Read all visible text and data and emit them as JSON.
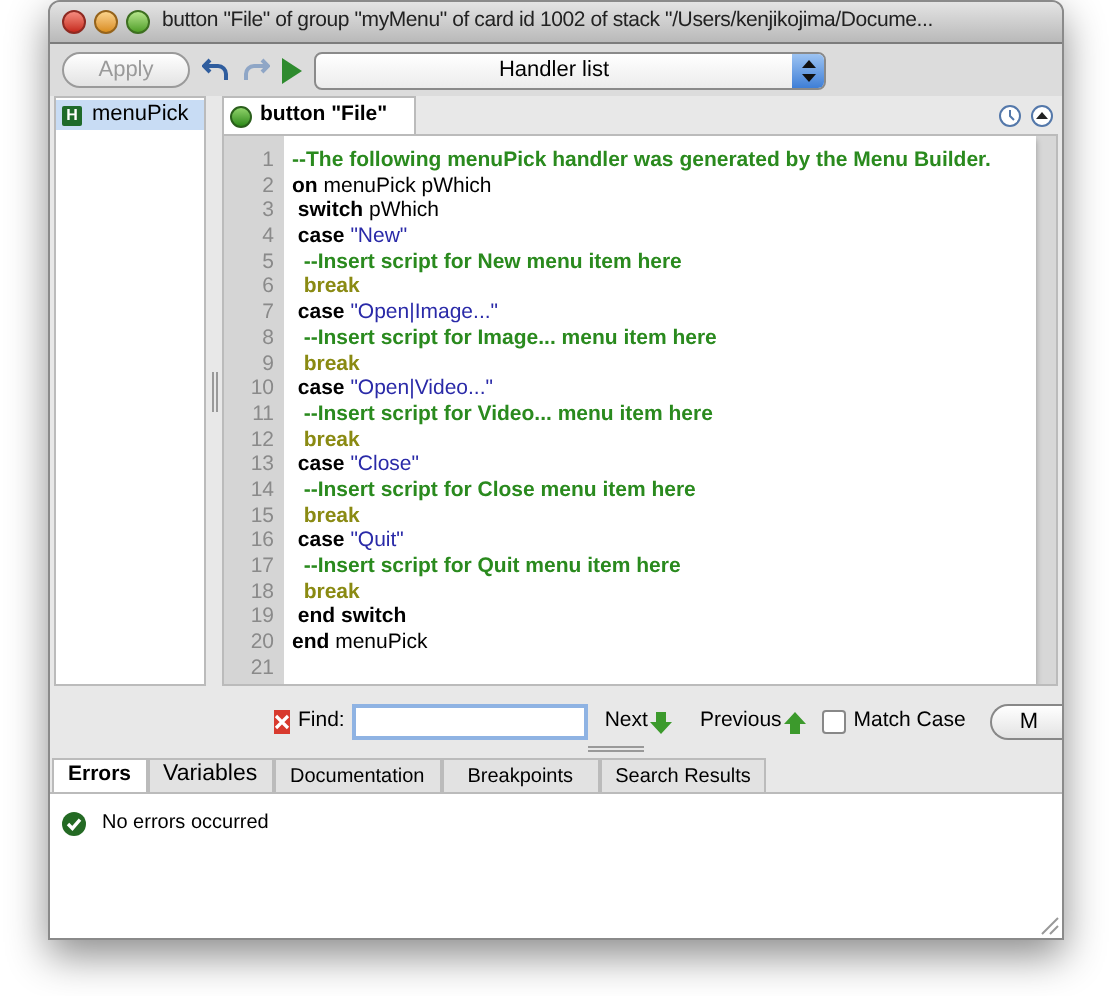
{
  "window": {
    "title": "button \"File\" of group \"myMenu\" of card id 1002 of stack \"/Users/kenjikojima/Docume..."
  },
  "toolbar": {
    "apply_button": {
      "label": "Apply",
      "disabled": true
    },
    "handler_list": {
      "value": "Handler list"
    }
  },
  "sidebar": {
    "items": [
      {
        "badge": "H",
        "label": "menuPick",
        "selected": true
      }
    ]
  },
  "editor": {
    "tab": {
      "label": "button \"File\""
    },
    "lines": [
      {
        "number": "1",
        "tokens": [
          {
            "kind": "comment",
            "text": "--The following menuPick handler was generated by the Menu Builder."
          }
        ]
      },
      {
        "number": "2",
        "tokens": [
          {
            "kind": "keyword",
            "text": "on"
          },
          {
            "kind": "plain",
            "text": " menuPick pWhich"
          }
        ]
      },
      {
        "number": "3",
        "tokens": [
          {
            "kind": "keyword",
            "text": " switch"
          },
          {
            "kind": "plain",
            "text": " pWhich"
          }
        ]
      },
      {
        "number": "4",
        "tokens": [
          {
            "kind": "keyword",
            "text": " case"
          },
          {
            "kind": "string",
            "text": " \"New\""
          }
        ]
      },
      {
        "number": "5",
        "tokens": [
          {
            "kind": "comment",
            "text": "  --Insert script for New menu item here"
          }
        ]
      },
      {
        "number": "6",
        "tokens": [
          {
            "kind": "break",
            "text": "  break"
          }
        ]
      },
      {
        "number": "7",
        "tokens": [
          {
            "kind": "keyword",
            "text": " case"
          },
          {
            "kind": "string",
            "text": " \"Open|Image...\""
          }
        ]
      },
      {
        "number": "8",
        "tokens": [
          {
            "kind": "comment",
            "text": "  --Insert script for Image... menu item here"
          }
        ]
      },
      {
        "number": "9",
        "tokens": [
          {
            "kind": "break",
            "text": "  break"
          }
        ]
      },
      {
        "number": "10",
        "tokens": [
          {
            "kind": "keyword",
            "text": " case"
          },
          {
            "kind": "string",
            "text": " \"Open|Video...\""
          }
        ]
      },
      {
        "number": "11",
        "tokens": [
          {
            "kind": "comment",
            "text": "  --Insert script for Video... menu item here"
          }
        ]
      },
      {
        "number": "12",
        "tokens": [
          {
            "kind": "break",
            "text": "  break"
          }
        ]
      },
      {
        "number": "13",
        "tokens": [
          {
            "kind": "keyword",
            "text": " case"
          },
          {
            "kind": "string",
            "text": " \"Close\""
          }
        ]
      },
      {
        "number": "14",
        "tokens": [
          {
            "kind": "comment",
            "text": "  --Insert script for Close menu item here"
          }
        ]
      },
      {
        "number": "15",
        "tokens": [
          {
            "kind": "break",
            "text": "  break"
          }
        ]
      },
      {
        "number": "16",
        "tokens": [
          {
            "kind": "keyword",
            "text": " case"
          },
          {
            "kind": "string",
            "text": " \"Quit\""
          }
        ]
      },
      {
        "number": "17",
        "tokens": [
          {
            "kind": "comment",
            "text": "  --Insert script for Quit menu item here"
          }
        ]
      },
      {
        "number": "18",
        "tokens": [
          {
            "kind": "break",
            "text": "  break"
          }
        ]
      },
      {
        "number": "19",
        "tokens": [
          {
            "kind": "keyword",
            "text": " end switch"
          }
        ]
      },
      {
        "number": "20",
        "tokens": [
          {
            "kind": "keyword",
            "text": "end"
          },
          {
            "kind": "plain",
            "text": " menuPick"
          }
        ]
      },
      {
        "number": "21"
      }
    ]
  },
  "find_bar": {
    "label": "Find:",
    "next": "Next",
    "previous": "Previous",
    "match_case": {
      "label": "Match Case",
      "checked": false
    },
    "button": "M"
  },
  "bottom_tabs": [
    {
      "label": "Errors",
      "selected": true
    },
    {
      "label": "Variables",
      "selected": false
    },
    {
      "label": "Documentation",
      "selected": false
    },
    {
      "label": "Breakpoints",
      "selected": false
    },
    {
      "label": "Search Results",
      "selected": false
    }
  ],
  "messages": [
    {
      "kind": "success",
      "text": "No errors occurred"
    }
  ]
}
